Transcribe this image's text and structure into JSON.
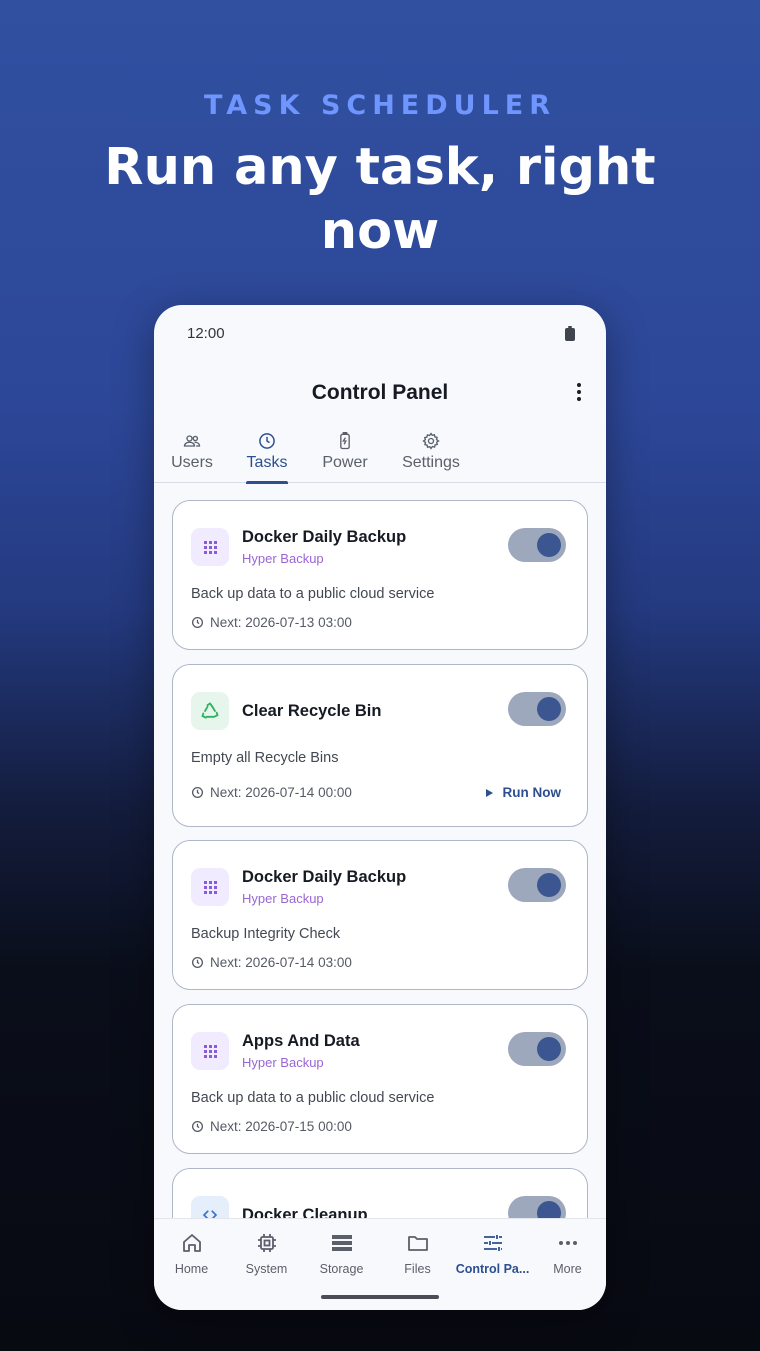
{
  "promo": {
    "eyebrow": "TASK SCHEDULER",
    "headline": "Run any task, right now"
  },
  "status_bar": {
    "time": "12:00",
    "battery_icon": "battery-icon"
  },
  "app_bar": {
    "title": "Control Panel",
    "menu_icon": "more-vert-icon"
  },
  "tabs": [
    {
      "label": "Users",
      "icon": "users-icon",
      "active": false
    },
    {
      "label": "Tasks",
      "icon": "clock-icon",
      "active": true
    },
    {
      "label": "Power",
      "icon": "battery-charging-icon",
      "active": false
    },
    {
      "label": "Settings",
      "icon": "gear-icon",
      "active": false
    }
  ],
  "tasks": [
    {
      "title": "Docker Daily Backup",
      "subtitle": "Hyper Backup",
      "description": "Back up data to a public cloud service",
      "next": "Next: 2026-07-13 03:00",
      "icon": "grid-icon",
      "enabled": true
    },
    {
      "title": "Clear Recycle Bin",
      "subtitle": "",
      "description": "Empty all Recycle Bins",
      "next": "Next: 2026-07-14 00:00",
      "icon": "recycle-icon",
      "enabled": true,
      "action_label": "Run Now"
    },
    {
      "title": "Docker Daily Backup",
      "subtitle": "Hyper Backup",
      "description": "Backup Integrity Check",
      "next": "Next: 2026-07-14 03:00",
      "icon": "grid-icon",
      "enabled": true
    },
    {
      "title": "Apps And Data",
      "subtitle": "Hyper Backup",
      "description": "Back up data to a public cloud service",
      "next": "Next: 2026-07-15 00:00",
      "icon": "grid-icon",
      "enabled": true
    },
    {
      "title": "Docker Cleanup",
      "icon": "code-icon",
      "enabled": true
    }
  ],
  "bottom_nav": [
    {
      "label": "Home",
      "icon": "home-icon",
      "active": false
    },
    {
      "label": "System",
      "icon": "chip-icon",
      "active": false
    },
    {
      "label": "Storage",
      "icon": "storage-icon",
      "active": false
    },
    {
      "label": "Files",
      "icon": "folder-icon",
      "active": false
    },
    {
      "label": "Control Pa...",
      "icon": "sliders-icon",
      "active": true
    },
    {
      "label": "More",
      "icon": "more-horiz-icon",
      "active": false
    }
  ],
  "colors": {
    "accent": "#2d4f8f",
    "toggle_track": "#9da8bd",
    "toggle_knob": "#3b5690",
    "subtitle": "#9a66d6",
    "eyebrow": "#6f95ff"
  }
}
